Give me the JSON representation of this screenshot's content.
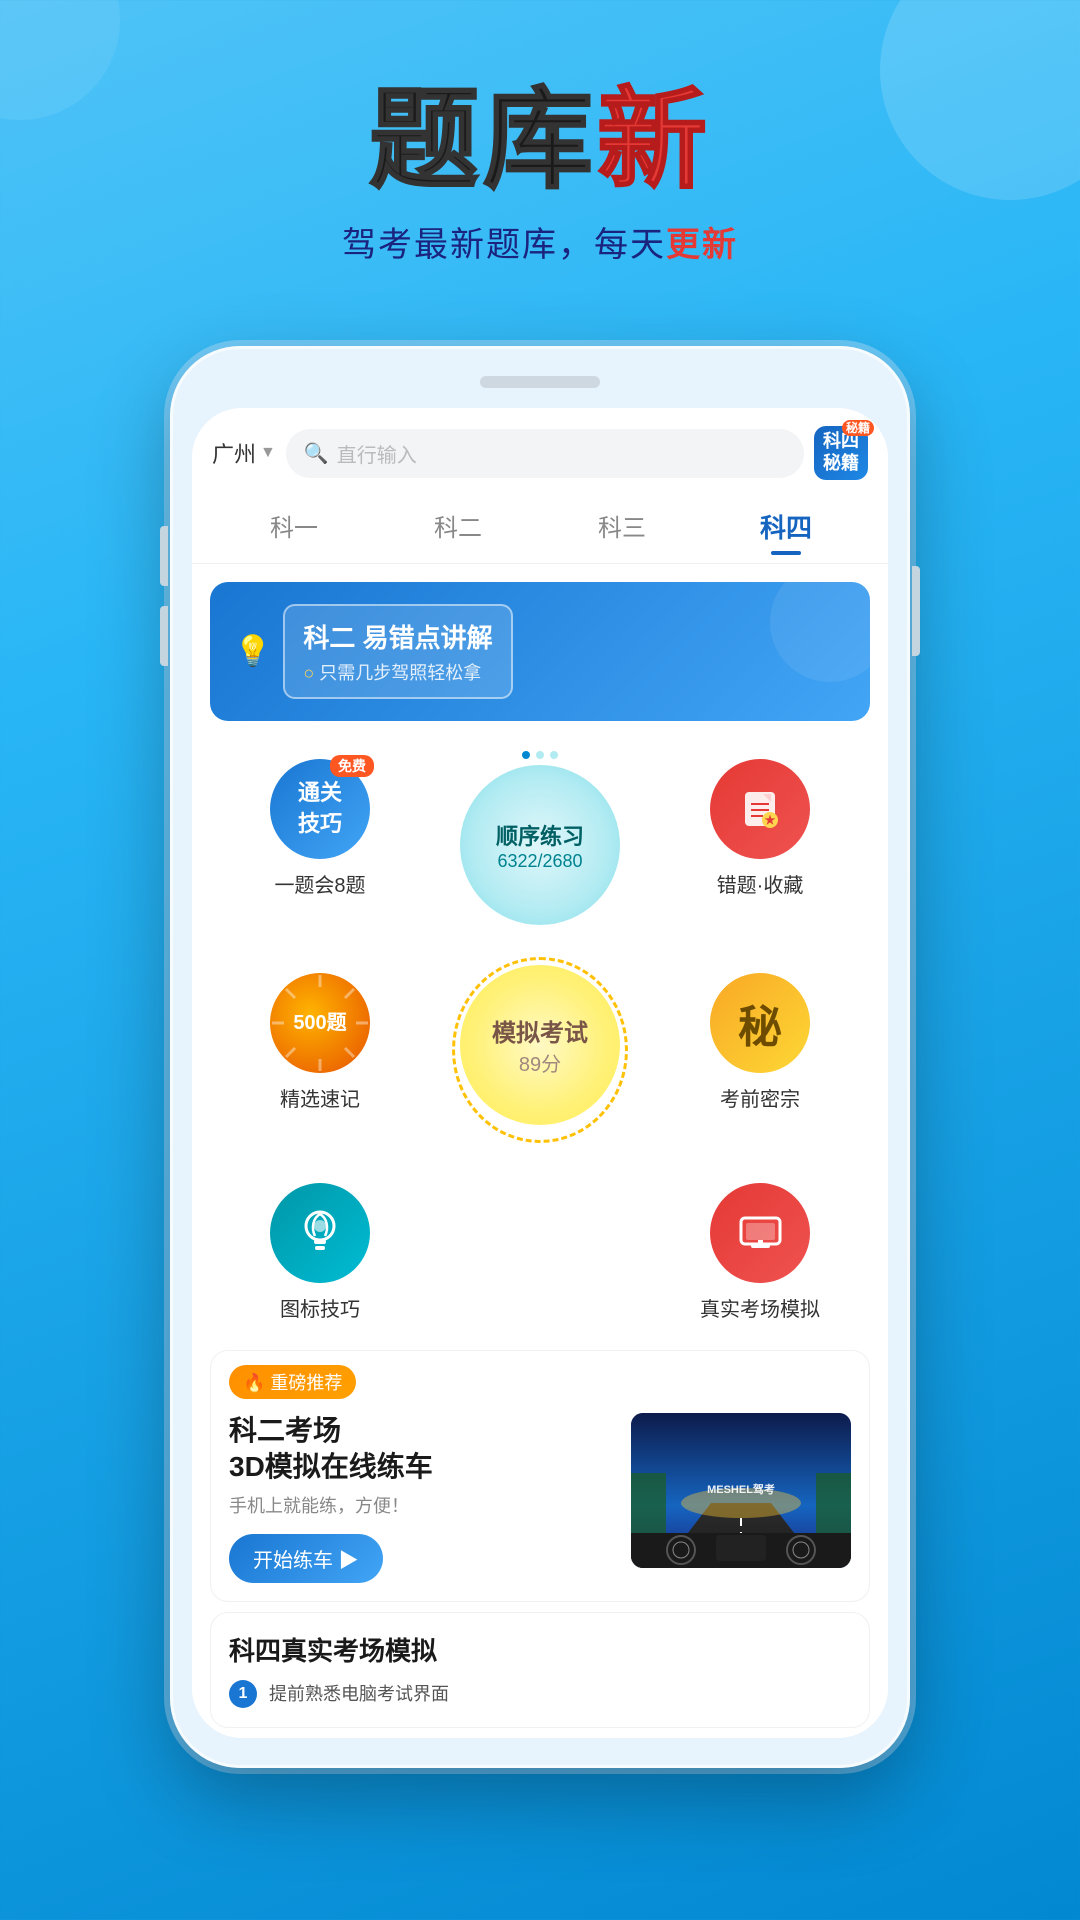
{
  "app": {
    "title": "题库新",
    "title_black": "题库",
    "title_red": "新",
    "subtitle": "驾考最新题库，每天",
    "subtitle_red": "更新"
  },
  "search": {
    "city": "广州",
    "placeholder": "直行输入",
    "secret_badge_line1": "科四",
    "secret_badge_line2": "秘籍"
  },
  "tabs": [
    {
      "label": "科一",
      "active": false
    },
    {
      "label": "科二",
      "active": false
    },
    {
      "label": "科三",
      "active": false
    },
    {
      "label": "科四",
      "active": true
    }
  ],
  "banner": {
    "title": "科二 易错点讲解",
    "subtitle": "只需几步驾照轻松拿",
    "bullet": "○"
  },
  "features": {
    "trick": {
      "label": "一题会8题",
      "title_line1": "通关",
      "title_line2": "技巧",
      "badge": "免费"
    },
    "sequential": {
      "title": "顺序练习",
      "progress": "6322/2680",
      "label": "顺序练习"
    },
    "wrong": {
      "label": "错题·收藏"
    },
    "speed": {
      "label": "精选速记",
      "badge": "500题"
    },
    "secret": {
      "label": "考前密宗",
      "char": "秘"
    },
    "mock": {
      "title": "模拟考试",
      "score": "89分",
      "label": "模拟考试"
    },
    "tips": {
      "label": "图标技巧"
    },
    "real": {
      "label": "真实考场模拟"
    }
  },
  "recommend": {
    "tag": "🔥 重磅推荐",
    "title": "科二考场\n3D模拟在线练车",
    "subtitle": "手机上就能练，方便！",
    "btn_label": "开始练车 ▶",
    "image_text": "MESHEL驾考"
  },
  "section2": {
    "title": "科四真实考场模拟",
    "item1": "提前熟悉电脑考试界面"
  },
  "colors": {
    "primary_blue": "#1976d2",
    "light_blue": "#42a5f5",
    "red": "#e53935",
    "orange": "#ff8f00",
    "yellow": "#fdd835",
    "teal": "#0097a7",
    "bg_gradient_start": "#4fc3f7",
    "bg_gradient_end": "#0288d1"
  }
}
